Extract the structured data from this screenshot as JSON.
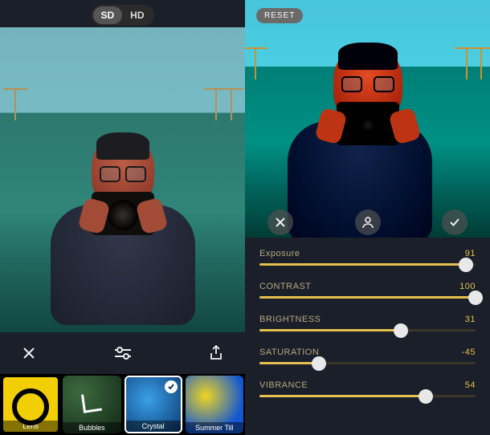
{
  "quality": {
    "options": [
      "SD",
      "HD"
    ],
    "active_index": 0
  },
  "left_toolbar": {
    "close_icon": "✕",
    "adjust_icon": "sliders",
    "share_icon": "share"
  },
  "filters": [
    {
      "label": "Lens",
      "selected": false
    },
    {
      "label": "Bubbles",
      "selected": true
    },
    {
      "label": "Crystal",
      "selected": false,
      "applied": true
    },
    {
      "label": "Summer Till",
      "selected": false
    }
  ],
  "right": {
    "reset_label": "RESET",
    "action_close": "✕",
    "action_portrait": "portrait",
    "action_confirm": "✓"
  },
  "sliders": [
    {
      "name": "Exposure",
      "value": 91,
      "min": -100,
      "max": 100
    },
    {
      "name": "CONTRAST",
      "value": 100,
      "min": -100,
      "max": 100
    },
    {
      "name": "BRIGHTNESS",
      "value": 31,
      "min": -100,
      "max": 100
    },
    {
      "name": "SATURATION",
      "value": -45,
      "min": -100,
      "max": 100
    },
    {
      "name": "VIBRANCE",
      "value": 54,
      "min": -100,
      "max": 100
    }
  ]
}
